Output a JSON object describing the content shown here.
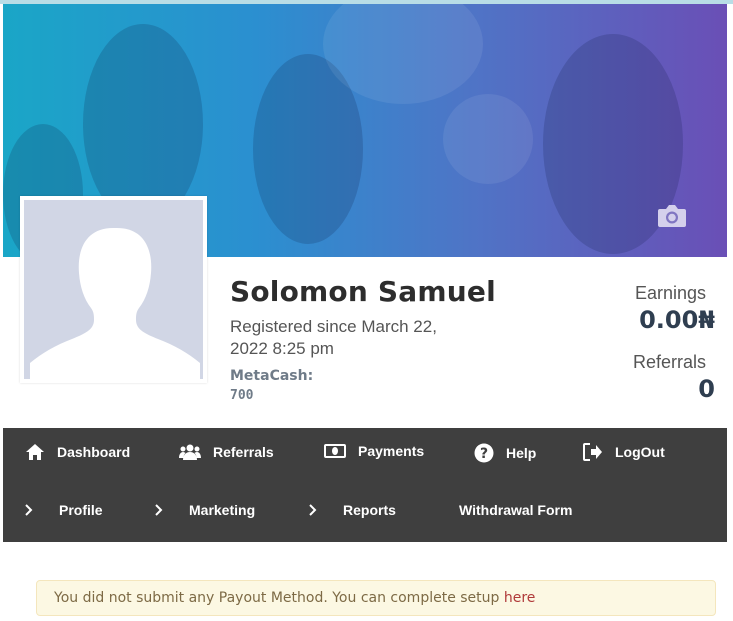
{
  "profile": {
    "name": "Solomon Samuel",
    "registered": "Registered since March 22, 2022 8:25 pm",
    "metacash_label": "MetaCash:",
    "metacash_value": "700"
  },
  "stats": {
    "earnings_label": "Earnings",
    "earnings_value": "0.00₦",
    "referrals_label": "Referrals",
    "referrals_value": "0"
  },
  "nav": {
    "row1": [
      {
        "label": "Dashboard",
        "icon": "home-icon"
      },
      {
        "label": "Referrals",
        "icon": "users-icon"
      },
      {
        "label": "Payments",
        "icon": "money-icon"
      },
      {
        "label": "Help",
        "icon": "question-icon"
      },
      {
        "label": "LogOut",
        "icon": "logout-icon"
      }
    ],
    "row2": [
      {
        "label": "Profile",
        "icon": "chevron-right-icon"
      },
      {
        "label": "Marketing",
        "icon": "chevron-right-icon"
      },
      {
        "label": "Reports",
        "icon": "chevron-right-icon"
      },
      {
        "label": "Withdrawal Form"
      }
    ]
  },
  "alert": {
    "message": "You did not submit any Payout Method. You can complete setup ",
    "link": "here"
  },
  "icons": {
    "cover_action": "camera-icon"
  },
  "colors": {
    "cover_start": "#1aa6c7",
    "cover_end": "#6a4fb6",
    "navbar": "#3f3f3f",
    "alert_bg": "#fcf8e3",
    "alert_link": "#b03a3a"
  }
}
